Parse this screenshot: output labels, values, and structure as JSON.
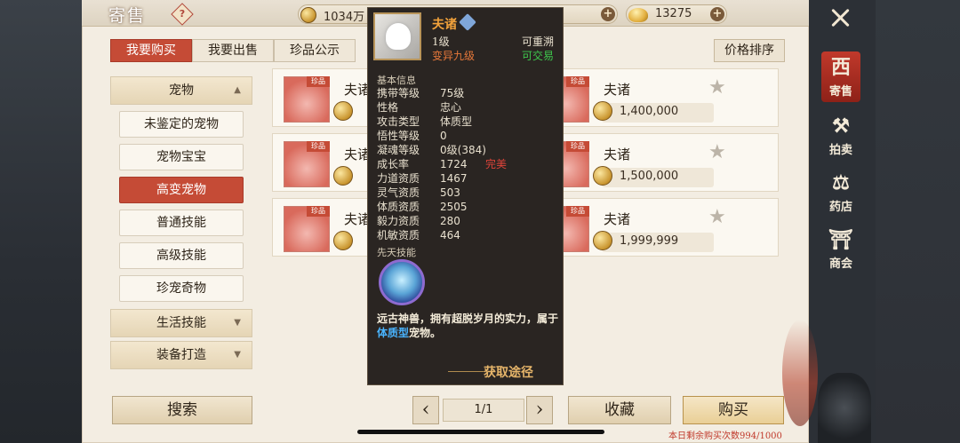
{
  "header": {
    "title": "寄售",
    "help_label": "?",
    "silver": "1034万",
    "gold": "13275"
  },
  "tabs": [
    {
      "label": "我要购买",
      "active": true
    },
    {
      "label": "我要出售",
      "active": false
    },
    {
      "label": "珍品公示",
      "active": false
    }
  ],
  "sort_label": "价格排序",
  "sidebar": {
    "categories": [
      {
        "label": "宠物",
        "arrow": "▲"
      },
      {
        "label": "生活技能",
        "arrow": "▼"
      },
      {
        "label": "装备打造",
        "arrow": "▼"
      }
    ],
    "subitems": [
      {
        "label": "未鉴定的宠物",
        "active": false
      },
      {
        "label": "宠物宝宝",
        "active": false
      },
      {
        "label": "高变宠物",
        "active": true
      },
      {
        "label": "普通技能",
        "active": false
      },
      {
        "label": "高级技能",
        "active": false
      },
      {
        "label": "珍宠奇物",
        "active": false
      }
    ]
  },
  "listings": [
    {
      "badge": "珍品",
      "name": "夫诸",
      "price": ""
    },
    {
      "badge": "珍品",
      "name": "夫诸",
      "price": "1,400,000"
    },
    {
      "badge": "珍品",
      "name": "夫诸",
      "price": ""
    },
    {
      "badge": "珍品",
      "name": "夫诸",
      "price": "1,500,000"
    },
    {
      "badge": "珍品",
      "name": "夫诸",
      "price": ""
    },
    {
      "badge": "珍品",
      "name": "夫诸",
      "price": "1,999,999"
    }
  ],
  "tooltip": {
    "name": "夫诸",
    "level": "1级",
    "rebirth": "可重溯",
    "mutation": "变异九级",
    "trade": "可交易",
    "section_basic": "基本信息",
    "stats": [
      {
        "key": "携带等级",
        "value": "75级",
        "tag": ""
      },
      {
        "key": "性格",
        "value": "忠心",
        "tag": ""
      },
      {
        "key": "攻击类型",
        "value": "体质型",
        "tag": ""
      },
      {
        "key": "悟性等级",
        "value": "0",
        "tag": ""
      },
      {
        "key": "凝魂等级",
        "value": "0级(384)",
        "tag": ""
      },
      {
        "key": "成长率",
        "value": "1724",
        "tag": "完美"
      },
      {
        "key": "力道资质",
        "value": "1467",
        "tag": ""
      },
      {
        "key": "灵气资质",
        "value": "503",
        "tag": ""
      },
      {
        "key": "体质资质",
        "value": "2505",
        "tag": ""
      },
      {
        "key": "毅力资质",
        "value": "280",
        "tag": ""
      },
      {
        "key": "机敏资质",
        "value": "464",
        "tag": ""
      }
    ],
    "section_skill": "先天技能",
    "desc_1": "远古神兽，拥有超脱岁月的实力，属于",
    "desc_hl": "体质型",
    "desc_2": "宠物。",
    "source": "获取途径"
  },
  "footer": {
    "search": "搜索",
    "page": "1/1",
    "favorite": "收藏",
    "buy": "购买",
    "remaining": "本日剩余购买次数994/1000"
  },
  "right_nav": [
    {
      "label": "寄售",
      "icon": "西",
      "active": true
    },
    {
      "label": "拍卖",
      "icon": "⚒",
      "active": false
    },
    {
      "label": "药店",
      "icon": "⚖",
      "active": false
    },
    {
      "label": "商会",
      "icon": "⛩",
      "active": false
    }
  ]
}
